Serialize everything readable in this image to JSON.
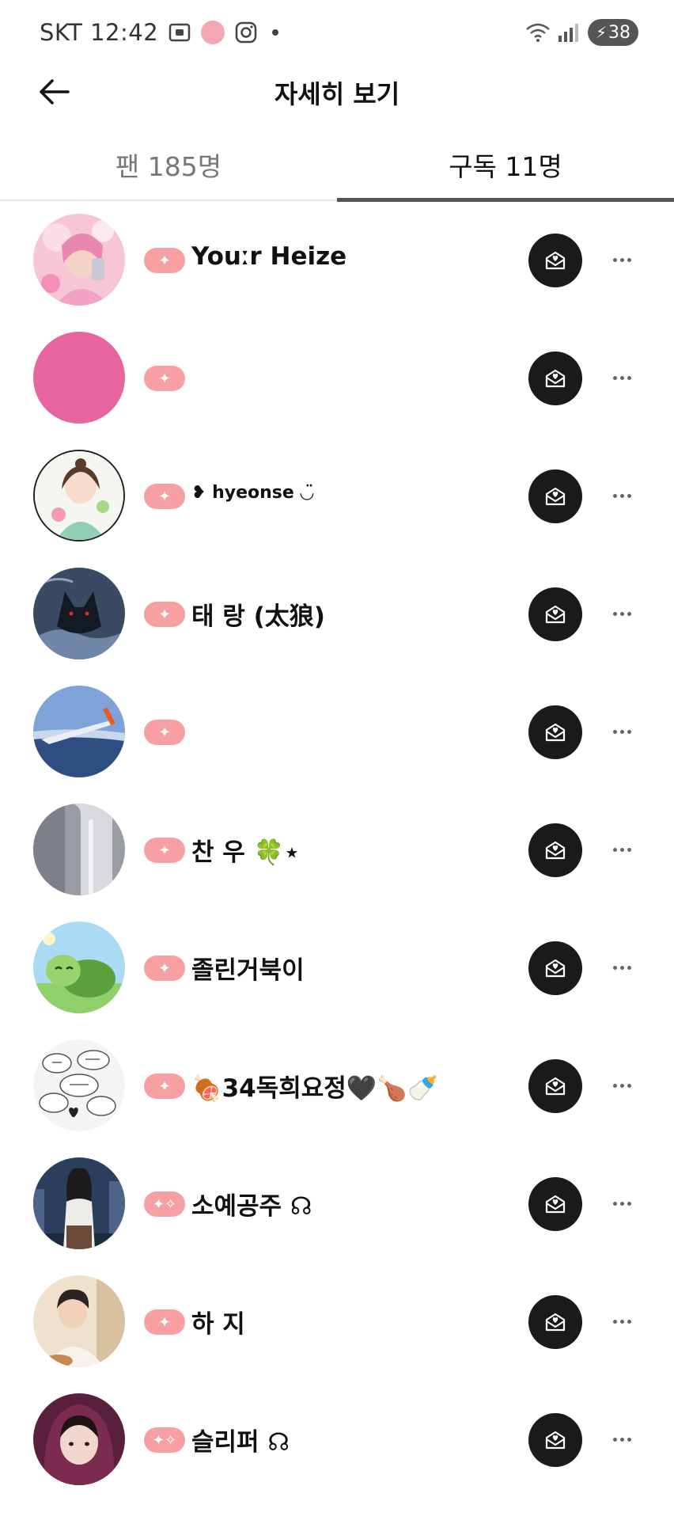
{
  "status_bar": {
    "carrier_time": "SKT 12:42",
    "battery": "38",
    "icons": [
      "screenshot-icon",
      "app-icon",
      "instagram-icon",
      "notification-dot-icon",
      "wifi-icon",
      "signal-icon",
      "battery-charging-icon"
    ]
  },
  "header": {
    "title": "자세히 보기",
    "back_icon": "arrow-left-icon"
  },
  "tabs": [
    {
      "label": "팬 185명",
      "active": false
    },
    {
      "label": "구독 11명",
      "active": true
    }
  ],
  "colors": {
    "badge": "#f7a0a4",
    "message_button": "#1a1a1a",
    "tab_indicator": "#555555"
  },
  "subscriptions": [
    {
      "name": "Youːr Heize",
      "avatar": "pink-selfie-avatar",
      "badge": "sparkle-badge-icon"
    },
    {
      "name": "",
      "avatar": "pink-solid-avatar",
      "badge": "sparkle-badge-icon"
    },
    {
      "name": "❥ hyeonse ◡̈",
      "avatar": "illustrated-girl-avatar",
      "badge": "sparkle-badge-icon"
    },
    {
      "name": "태 랑 (太狼)",
      "avatar": "dark-wolf-avatar",
      "badge": "sparkle-badge-icon"
    },
    {
      "name": "",
      "avatar": "airplane-wing-avatar",
      "badge": "sparkle-badge-icon"
    },
    {
      "name": "찬 우 🍀⋆",
      "avatar": "grey-object-avatar",
      "badge": "sparkle-badge-icon"
    },
    {
      "name": "졸린거북이",
      "avatar": "cartoon-turtle-avatar",
      "badge": "sparkle-badge-icon"
    },
    {
      "name": "🍖34독희요정🖤🍗🍼",
      "avatar": "speech-bubbles-avatar",
      "badge": "sparkle-badge-icon"
    },
    {
      "name": "소예공주 ☊",
      "avatar": "city-girl-avatar",
      "badge": "double-sparkle-badge-icon"
    },
    {
      "name": "하 지",
      "avatar": "boy-illustration-avatar",
      "badge": "sparkle-badge-icon"
    },
    {
      "name": "슬리퍼 ☊",
      "avatar": "hoodie-girl-avatar",
      "badge": "double-sparkle-badge-icon"
    }
  ]
}
